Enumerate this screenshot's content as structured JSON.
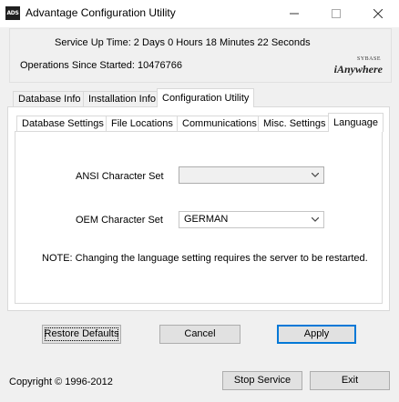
{
  "window": {
    "title": "Advantage Configuration Utility",
    "app_icon_text": "ADS",
    "minimize_glyph": "—",
    "maximize_glyph": "☐",
    "close_glyph": "✕"
  },
  "header": {
    "uptime": "Service Up Time:  2 Days 0 Hours 18 Minutes 22 Seconds",
    "operations": "Operations Since Started: 10476766",
    "logo_small": "SYBASE",
    "logo_main": "iAnywhere"
  },
  "outer_tabs": [
    {
      "label": "Database Info"
    },
    {
      "label": "Installation Info"
    },
    {
      "label": "Configuration Utility"
    }
  ],
  "inner_tabs": [
    {
      "label": "Database Settings"
    },
    {
      "label": "File Locations"
    },
    {
      "label": "Communications"
    },
    {
      "label": "Misc. Settings"
    },
    {
      "label": "Language"
    }
  ],
  "language": {
    "ansi_label": "ANSI Character Set",
    "ansi_value": "",
    "oem_label": "OEM Character Set",
    "oem_value": "GERMAN",
    "note": "NOTE: Changing the language setting requires the server to be restarted."
  },
  "buttons": {
    "restore_defaults": "Restore Defaults",
    "cancel": "Cancel",
    "apply": "Apply",
    "stop_service": "Stop Service",
    "exit": "Exit"
  },
  "footer": {
    "copyright": "Copyright © 1996-2012"
  },
  "colors": {
    "focus_border": "#0078d7",
    "window_bg": "#f0f0f0"
  }
}
